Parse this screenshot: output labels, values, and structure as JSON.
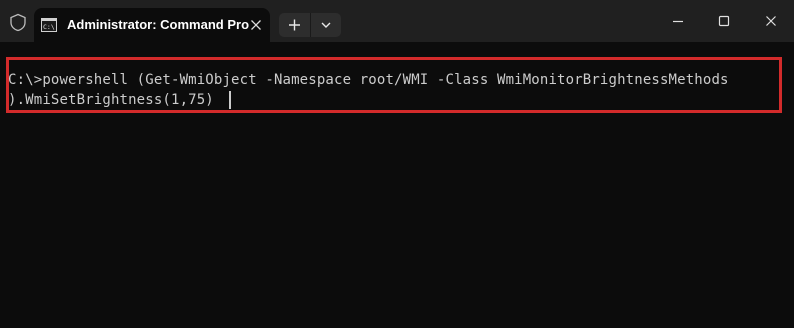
{
  "window": {
    "tab_title": "Administrator: Command Pro"
  },
  "icons": {
    "shield": "shield-icon",
    "tab": "terminal-icon",
    "close_tab": "close-icon",
    "new_tab": "plus-icon",
    "dropdown": "chevron-down-icon",
    "minimize": "minimize-icon",
    "maximize": "maximize-icon",
    "close_window": "close-icon"
  },
  "console": {
    "line1": "C:\\>powershell (Get-WmiObject -Namespace root/WMI -Class WmiMonitorBrightnessMethods",
    "line2": ").WmiSetBrightness(1,75)"
  },
  "colors": {
    "titlebar": "#202020",
    "background": "#0c0c0c",
    "text": "#cccccc",
    "highlight": "#d32b2b"
  }
}
